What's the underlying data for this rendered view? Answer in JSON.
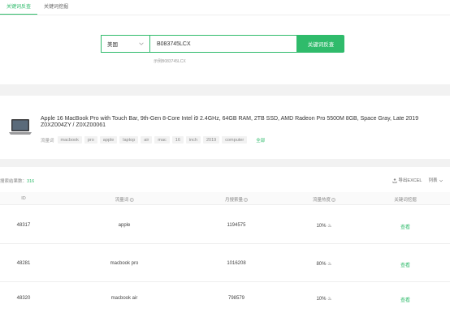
{
  "tabs": [
    {
      "label": "关键词反查",
      "active": true
    },
    {
      "label": "关键词挖掘",
      "active": false
    }
  ],
  "search": {
    "country": "美国",
    "asin_value": "B083745LCX",
    "button_label": "关键词反查",
    "example_text": "示例B083745LCX"
  },
  "product": {
    "title": "Apple 16 MacBook Pro with Touch Bar, 9th-Gen 8-Core Intel i9 2.4GHz, 64GB RAM, 2TB SSD, AMD Radeon Pro 5500M 8GB, Space Gray, Late 2019 Z0XZ004ZY / Z0XZ00061",
    "tags_label": "流量词",
    "tags": [
      "macbook",
      "pro",
      "apple",
      "laptop",
      "air",
      "mac",
      "16",
      "inch",
      "2019",
      "computer"
    ],
    "all_link": "全部"
  },
  "results": {
    "summary_label": "搜索结果数：",
    "count": "316",
    "export_label": "导出EXCEL",
    "columns_label": "列表"
  },
  "table": {
    "headers": {
      "id": "ID",
      "keyword": "流量词",
      "volume": "月搜索量",
      "heat": "流量热度",
      "trend": "关键词挖掘"
    },
    "rows": [
      {
        "id": "48317",
        "keyword": "apple",
        "volume": "1194575",
        "heat": "10%",
        "trend": "查看"
      },
      {
        "id": "48281",
        "keyword": "macbook pro",
        "volume": "1016208",
        "heat": "80%",
        "trend": "查看"
      },
      {
        "id": "48320",
        "keyword": "macbook air",
        "volume": "798579",
        "heat": "10%",
        "trend": "查看"
      }
    ]
  },
  "colors": {
    "accent": "#2fbb6b"
  }
}
